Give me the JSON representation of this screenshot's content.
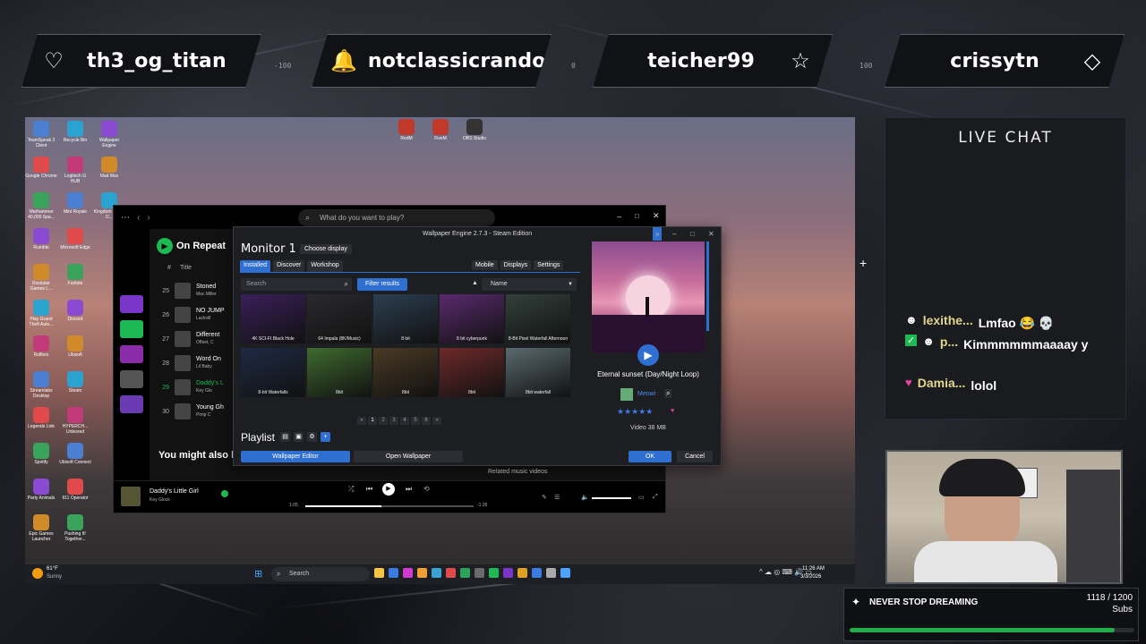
{
  "top_bar": {
    "users": [
      {
        "name": "th3_og_titan",
        "icon": "heart-icon"
      },
      {
        "name": "notclassicrando",
        "icon": "bell-icon"
      },
      {
        "name": "teicher99",
        "icon": "star-icon"
      },
      {
        "name": "crissytn",
        "icon": "diamond-icon"
      }
    ],
    "ticks": [
      "-100",
      "0",
      "100"
    ]
  },
  "desktop": {
    "icons_col1": [
      "TeamSpeak 3 Client",
      "Google Chrome",
      "Warhammer 40,000 Spa...",
      "Rumble",
      "Rockstar Games L...",
      "Play Grand Theft Auto...",
      "Rollbox",
      "Streamlabs Desktop",
      "Legends Link",
      "Spotify",
      "Party Animals",
      "Epic Games Launcher"
    ],
    "icons_col2": [
      "Recycle Bin",
      "Logitech G HUB",
      "Mini Royale",
      "Microsoft Edge",
      "Fortnite",
      "Discord",
      "Ubisoft",
      "Steam",
      "HYPERCH... Unboxed",
      "Ubisoft Connect",
      "911 Operator",
      "Pushing It! Together..."
    ],
    "icons_col3": [
      "Wallpaper Engine",
      "Mad Max",
      "Kingdom Come D..."
    ],
    "icons_top": [
      "RedM",
      "FiveM",
      "OBS Studio"
    ]
  },
  "spotify": {
    "search_placeholder": "What do you want to play?",
    "playlist_title": "On Repeat",
    "col_title": "Title",
    "rows": [
      {
        "n": "25",
        "title": "Stoned",
        "artist": "Mac Miller"
      },
      {
        "n": "26",
        "title": "NO JUMP",
        "artist": "Lackvill"
      },
      {
        "n": "27",
        "title": "Different",
        "artist": "Offset, C"
      },
      {
        "n": "28",
        "title": "Word On",
        "artist": "Lil Baby"
      },
      {
        "n": "29",
        "title": "Daddy's L",
        "artist": "Key Glo"
      },
      {
        "n": "30",
        "title": "Young Gh",
        "artist": "Pimp C"
      }
    ],
    "you_might": "You might also li",
    "related": "Related music videos",
    "now_playing": {
      "title": "Daddy's Little Girl",
      "artist": "Key Glock",
      "elapsed": "1:05",
      "remaining": "-1:26",
      "progress": 0.45
    }
  },
  "wallpaper_engine": {
    "title": "Wallpaper Engine 2.7.3 - Steam Edition",
    "monitor": "Monitor 1",
    "choose_display": "Choose display",
    "tabs": [
      "Installed",
      "Discover",
      "Workshop"
    ],
    "right_tabs": [
      "Mobile",
      "Displays",
      "Settings"
    ],
    "search_placeholder": "Search",
    "filter": "Filter results",
    "sort": "Name",
    "tiles": [
      {
        "caption": "4K SCI-FI Black Hole",
        "color": "#3a1f5a"
      },
      {
        "caption": "64 Impala (8K/Music)",
        "color": "#2a2a2e"
      },
      {
        "caption": "8 bit",
        "color": "#2c3f52"
      },
      {
        "caption": "8 bit cyberpunk",
        "color": "#5a2a6e"
      },
      {
        "caption": "8-Bit Pixel Waterfall Afternoon",
        "color": "#33403a"
      },
      {
        "caption": "8-bit Waterfalls",
        "color": "#1e2a44"
      },
      {
        "caption": "8bit",
        "color": "#3e6b2f"
      },
      {
        "caption": "8bit",
        "color": "#4a3a24"
      },
      {
        "caption": "8bit",
        "color": "#6e2a2a"
      },
      {
        "caption": "8bit waterfall",
        "color": "#5a6a6e"
      }
    ],
    "pages": [
      "«",
      "1",
      "2",
      "3",
      "4",
      "5",
      "6",
      "»"
    ],
    "playlist": "Playlist",
    "editor_btn": "Wallpaper Editor",
    "open_btn": "Open Wallpaper",
    "ok": "OK",
    "cancel": "Cancel",
    "preview": {
      "title": "Eternal sunset (Day/Night Loop)",
      "author": "Meowi",
      "stars": "★★★★★",
      "info": "Video 38 MB"
    }
  },
  "chat": {
    "title": "LIVE CHAT",
    "messages": [
      {
        "user": "lexithe...",
        "msg": "Lmfao 😂 💀"
      },
      {
        "user": "p...",
        "msg": "Kimmmmmmaaaay y"
      },
      {
        "user": "Damia...",
        "msg": "lolol"
      }
    ]
  },
  "taskbar": {
    "weather_temp": "61°F",
    "weather_desc": "Sunny",
    "search": "Search",
    "time": "11:26 AM",
    "date": "3/3/2026"
  },
  "goal": {
    "label": "NEVER STOP DREAMING",
    "count": "1118 / 1200",
    "unit": "Subs",
    "progress": 0.9317,
    "color": "#1fae4a"
  }
}
